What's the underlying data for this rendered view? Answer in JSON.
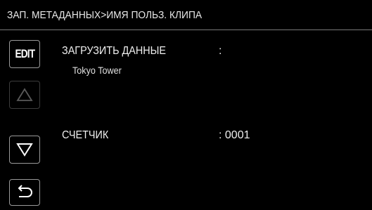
{
  "header": {
    "title": "ЗАП. МЕТАДАННЫХ>ИМЯ ПОЛЬЗ. КЛИПА"
  },
  "buttons": {
    "edit_label": "EDIT"
  },
  "rows": [
    {
      "label": "ЗАГРУЗИТЬ ДАННЫЕ",
      "value": ":",
      "sub": "Tokyo Tower"
    },
    {
      "label": "СЧЕТЧИК",
      "value": ": 0001"
    }
  ],
  "icons": {
    "up": "triangle-up-icon",
    "down": "triangle-down-icon",
    "back": "return-arrow-icon"
  },
  "colors": {
    "background": "#000000",
    "text": "#ffffff",
    "border": "#9a9a9a",
    "disabled_border": "#3c3c3c"
  }
}
